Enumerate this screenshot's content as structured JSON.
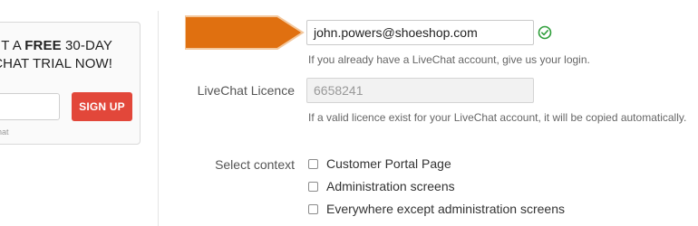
{
  "promo": {
    "headline_line1_prefix": "T A",
    "headline_line1_bold": "FREE",
    "headline_line1_suffix": "30-DAY",
    "headline_line2": "CHAT TRIAL NOW!",
    "signup_label": "SIGN UP",
    "powered_note": "veChat",
    "button_color": "#e2473a"
  },
  "form": {
    "email_value": "john.powers@shoeshop.com",
    "email_help": "If you already have a LiveChat account, give us your login.",
    "licence_label": "LiveChat Licence",
    "licence_value": "6658241",
    "licence_help": "If a valid licence exist for your LiveChat account, it will be copied automatically.",
    "context_label": "Select context",
    "context_options": [
      "Customer Portal Page",
      "Administration screens",
      "Everywhere except administration screens"
    ]
  },
  "colors": {
    "arrow": "#e07010",
    "valid": "#2e9e3a"
  },
  "icons": {
    "valid": "check-circle-icon"
  }
}
